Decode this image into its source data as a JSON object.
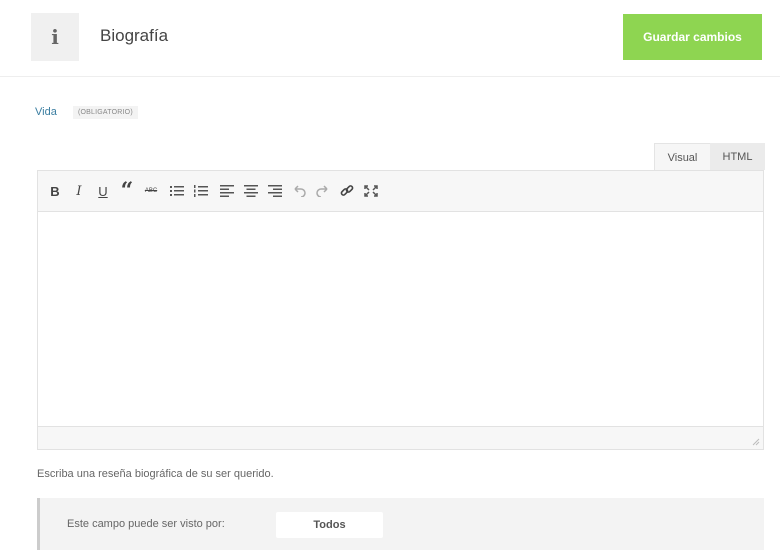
{
  "header": {
    "icon": "info-icon",
    "icon_glyph": "i",
    "title": "Biografía",
    "save_label": "Guardar cambios",
    "save_color": "#8ed551"
  },
  "field": {
    "label": "Vida",
    "required_badge": "(OBLIGATORIO)",
    "label_color": "#3b7ea1"
  },
  "editor": {
    "tabs": [
      {
        "label": "Visual",
        "active": true
      },
      {
        "label": "HTML",
        "active": false
      }
    ],
    "toolbar": [
      {
        "name": "bold",
        "glyph": "B"
      },
      {
        "name": "italic",
        "glyph": "I"
      },
      {
        "name": "underline",
        "glyph": "U"
      },
      {
        "name": "blockquote",
        "glyph": "“"
      },
      {
        "name": "strikethrough",
        "glyph": "ABC"
      },
      {
        "name": "bullet-list",
        "glyph": ""
      },
      {
        "name": "numbered-list",
        "glyph": ""
      },
      {
        "name": "align-left",
        "glyph": ""
      },
      {
        "name": "align-center",
        "glyph": ""
      },
      {
        "name": "align-right",
        "glyph": ""
      },
      {
        "name": "undo",
        "glyph": ""
      },
      {
        "name": "redo",
        "glyph": ""
      },
      {
        "name": "link",
        "glyph": ""
      },
      {
        "name": "fullscreen",
        "glyph": ""
      }
    ],
    "content": ""
  },
  "help_text": "Escriba una reseña biográfica de su ser querido.",
  "visibility": {
    "label": "Este campo puede ser visto por:",
    "value": "Todos"
  }
}
